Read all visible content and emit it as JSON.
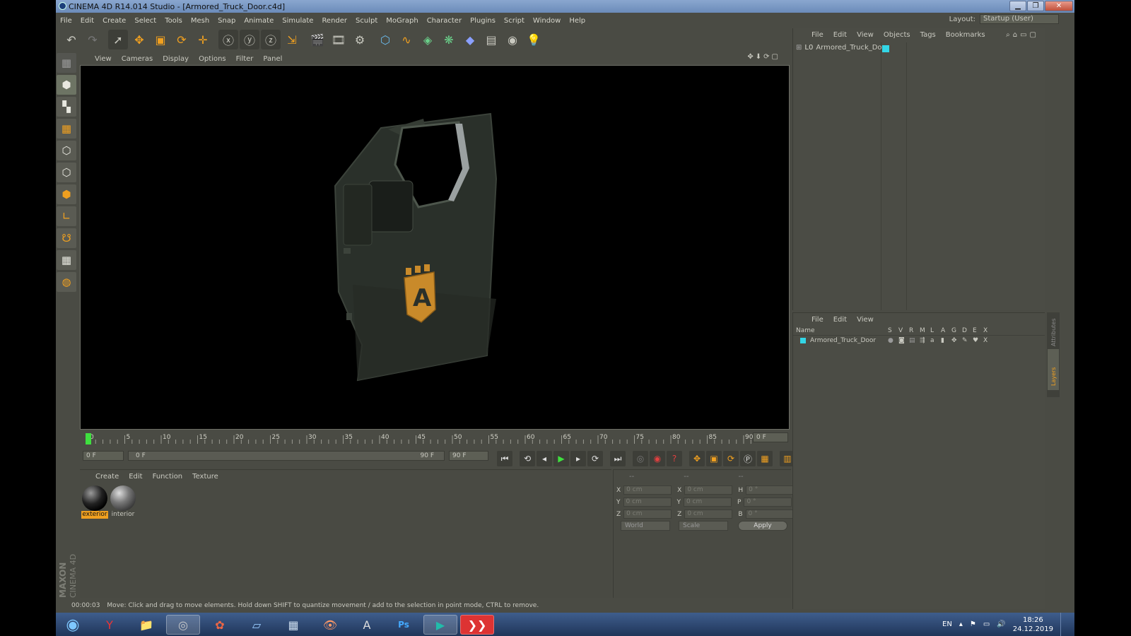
{
  "window": {
    "title": "CINEMA 4D R14.014 Studio - [Armored_Truck_Door.c4d]"
  },
  "menubar": {
    "items": [
      "File",
      "Edit",
      "Create",
      "Select",
      "Tools",
      "Mesh",
      "Snap",
      "Animate",
      "Simulate",
      "Render",
      "Sculpt",
      "MoGraph",
      "Character",
      "Plugins",
      "Script",
      "Window",
      "Help"
    ]
  },
  "layout": {
    "label": "Layout:",
    "value": "Startup (User)"
  },
  "viewport": {
    "menu": [
      "View",
      "Cameras",
      "Display",
      "Options",
      "Filter",
      "Panel"
    ],
    "emblem_letter": "A"
  },
  "timeline": {
    "ticks": [
      "0",
      "5",
      "10",
      "15",
      "20",
      "25",
      "30",
      "35",
      "40",
      "45",
      "50",
      "55",
      "60",
      "65",
      "70",
      "75",
      "80",
      "85",
      "90"
    ],
    "current_frame": "0 F"
  },
  "transport": {
    "start": "0 F",
    "range_start": "0 F",
    "range_end": "90 F",
    "end": "90 F"
  },
  "materials": {
    "menu": [
      "Create",
      "Edit",
      "Function",
      "Texture"
    ],
    "items": [
      "exterior",
      "interior"
    ]
  },
  "coordinates": {
    "headers": [
      "--",
      "--",
      "--"
    ],
    "rows": [
      {
        "a": "X",
        "av": "0 cm",
        "b": "X",
        "bv": "0 cm",
        "c": "H",
        "cv": "0 °"
      },
      {
        "a": "Y",
        "av": "0 cm",
        "b": "Y",
        "bv": "0 cm",
        "c": "P",
        "cv": "0 °"
      },
      {
        "a": "Z",
        "av": "0 cm",
        "b": "Z",
        "bv": "0 cm",
        "c": "B",
        "cv": "0 °"
      }
    ],
    "space": "World",
    "mode": "Scale",
    "apply": "Apply"
  },
  "objects": {
    "menu": [
      "File",
      "Edit",
      "View",
      "Objects",
      "Tags",
      "Bookmarks"
    ],
    "item": "Armored_Truck_Door"
  },
  "layers": {
    "menu": [
      "File",
      "Edit",
      "View"
    ],
    "name_header": "Name",
    "columns": [
      "S",
      "V",
      "R",
      "M",
      "L",
      "A",
      "G",
      "D",
      "E",
      "X"
    ],
    "item": "Armored_Truck_Door"
  },
  "sidetabs": {
    "attributes": "Attributes",
    "layers": "Layers"
  },
  "brand": {
    "maxon": "MAXON",
    "product": "CINEMA 4D"
  },
  "status": {
    "time": "00:00:03",
    "message": "Move: Click and drag to move elements. Hold down SHIFT to quantize movement / add to the selection in point mode, CTRL to remove."
  },
  "taskbar": {
    "lang": "EN",
    "time": "18:26",
    "date": "24.12.2019"
  },
  "colors": {
    "accent": "#f0a020",
    "layer": "#33d6e6",
    "play": "#3fe03f"
  }
}
